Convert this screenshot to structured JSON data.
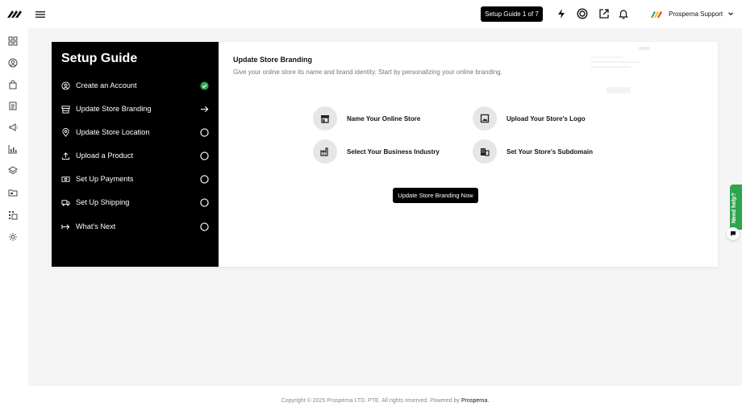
{
  "topbar": {
    "setup_pill": "Setup Guide 1 of 7",
    "brand_name": "Prosperna Support",
    "icons": [
      "logo-icon",
      "menu-icon",
      "bolt-icon",
      "target-icon",
      "external-link-icon",
      "bell-icon",
      "chevron-down-icon"
    ]
  },
  "sidebar": {
    "icons": [
      "dashboard-icon",
      "user-circle-icon",
      "shopping-bag-icon",
      "clipboard-icon",
      "megaphone-icon",
      "bar-chart-icon",
      "layers-icon",
      "folder-icon",
      "grid-dots-icon",
      "settings-icon"
    ]
  },
  "guide": {
    "title": "Setup Guide",
    "steps": [
      {
        "label": "Create an Account",
        "icon": "user-circle-icon",
        "status": "done"
      },
      {
        "label": "Update Store Branding",
        "icon": "storefront-icon",
        "status": "current"
      },
      {
        "label": "Update Store Location",
        "icon": "location-pin-icon",
        "status": "pending"
      },
      {
        "label": "Upload a Product",
        "icon": "upload-icon",
        "status": "pending"
      },
      {
        "label": "Set Up Payments",
        "icon": "payments-icon",
        "status": "pending"
      },
      {
        "label": "Set Up Shipping",
        "icon": "truck-icon",
        "status": "pending"
      },
      {
        "label": "What's Next",
        "icon": "arrow-to-icon",
        "status": "pending"
      }
    ]
  },
  "panel": {
    "title": "Update Store Branding",
    "subtitle": "Give your online store its name and brand identity. Start by personalizing your online branding.",
    "tasks": [
      {
        "label": "Name Your Online Store",
        "icon": "storefront-icon"
      },
      {
        "label": "Upload Your Store's Logo",
        "icon": "image-icon"
      },
      {
        "label": "Select Your Business Industry",
        "icon": "factory-icon"
      },
      {
        "label": "Set Your Store's Subdomain",
        "icon": "building-icon"
      }
    ],
    "cta": "Update Store Branding Now"
  },
  "help": {
    "label": "Need help?"
  },
  "footer": {
    "text": "Copyright © 2025 Prosperna LTD. PTE. All rights reserved. Powered by",
    "brand": "Prosperna."
  },
  "colors": {
    "accent": "#000000",
    "success": "#2ea44f",
    "muted_text": "#777777"
  }
}
